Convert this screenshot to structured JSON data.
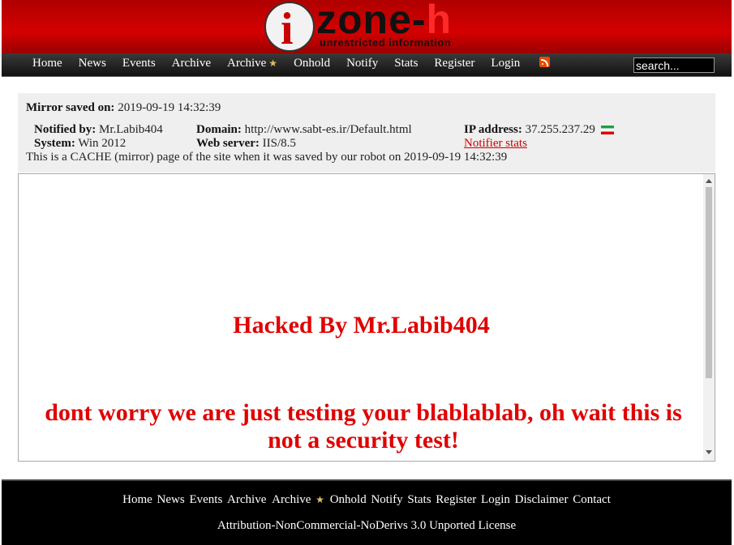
{
  "header": {
    "logo_wordmark_dark": "zone-",
    "logo_wordmark_red": "h",
    "logo_tagline": "unrestricted information"
  },
  "nav": {
    "items": [
      "Home",
      "News",
      "Events",
      "Archive",
      "Archive",
      "Onhold",
      "Notify",
      "Stats",
      "Register",
      "Login"
    ],
    "search_placeholder": "search..."
  },
  "info": {
    "mirror_saved_label": "Mirror saved on:",
    "mirror_saved_value": "2019-09-19 14:32:39",
    "notified_by_label": "Notified by:",
    "notified_by_value": "Mr.Labib404",
    "domain_label": "Domain:",
    "domain_value": "http://www.sabt-es.ir/Default.html",
    "ip_label": "IP address:",
    "ip_value": "37.255.237.29",
    "system_label": "System:",
    "system_value": "Win 2012",
    "web_server_label": "Web server:",
    "web_server_value": "IIS/8.5",
    "notifier_stats_link": "Notifier stats",
    "cache_note": "This is a CACHE (mirror) page of the site when it was saved by our robot on 2019-09-19 14:32:39"
  },
  "mirror": {
    "heading": "Hacked By Mr.Labib404",
    "message": "dont worry we are just testing your blablablab, oh wait this is not a security test!"
  },
  "footer": {
    "links": [
      "Home",
      "News",
      "Events",
      "Archive",
      "Archive",
      "Onhold",
      "Notify",
      "Stats",
      "Register",
      "Login",
      "Disclaimer",
      "Contact"
    ],
    "license": "Attribution-NonCommercial-NoDerivs 3.0 Unported License"
  },
  "colors": {
    "header_red": "#d40000",
    "nav_dark": "#1a1a1a",
    "hack_text_red": "#e00000",
    "link_red": "#cc0000",
    "footer_black": "#000000"
  },
  "icons": [
    "globe-logo-icon",
    "star-icon",
    "rss-icon",
    "iran-flag-icon"
  ]
}
